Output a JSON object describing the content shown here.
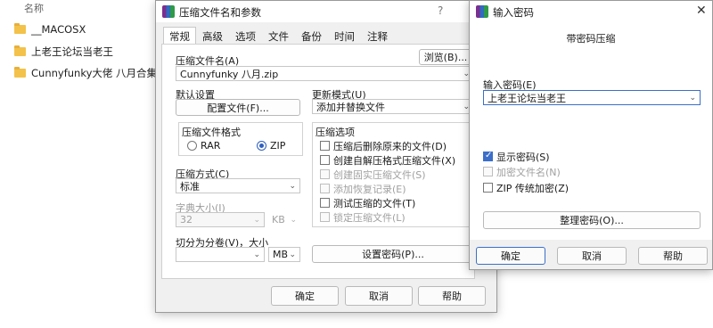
{
  "explorer": {
    "header": "名称",
    "items": [
      {
        "name": "__MACOSX"
      },
      {
        "name": "上老王论坛当老王"
      },
      {
        "name": "Cunnyfunky大佬 八月合集"
      }
    ]
  },
  "archive_dialog": {
    "title": "压缩文件名和参数",
    "help_mark": "?",
    "tabs": [
      "常规",
      "高级",
      "选项",
      "文件",
      "备份",
      "时间",
      "注释"
    ],
    "archive_name_label": "压缩文件名(A)",
    "browse_label": "浏览(B)...",
    "archive_name_value": "Cunnyfunky 八月.zip",
    "default_settings_label": "默认设置",
    "profiles_label": "配置文件(F)...",
    "update_mode_label": "更新模式(U)",
    "update_mode_value": "添加并替换文件",
    "format_label": "压缩文件格式",
    "format_rar": "RAR",
    "format_zip": "ZIP",
    "method_label": "压缩方式(C)",
    "method_value": "标准",
    "dict_label": "字典大小(I)",
    "dict_value": "32",
    "dict_unit": "KB",
    "split_label": "切分为分卷(V)，大小",
    "split_value": "",
    "split_unit": "MB",
    "set_password_label": "设置密码(P)...",
    "options_label": "压缩选项",
    "options": [
      {
        "label": "压缩后删除原来的文件(D)",
        "disabled": false
      },
      {
        "label": "创建自解压格式压缩文件(X)",
        "disabled": false
      },
      {
        "label": "创建固实压缩文件(S)",
        "disabled": true
      },
      {
        "label": "添加恢复记录(E)",
        "disabled": true
      },
      {
        "label": "测试压缩的文件(T)",
        "disabled": false
      },
      {
        "label": "锁定压缩文件(L)",
        "disabled": true
      }
    ],
    "ok_label": "确定",
    "cancel_label": "取消",
    "help_label": "帮助"
  },
  "password_dialog": {
    "title": "输入密码",
    "close_glyph": "✕",
    "subtitle": "带密码压缩",
    "enter_label": "输入密码(E)",
    "password_value": "上老王论坛当老王",
    "show_password_label": "显示密码(S)",
    "encrypt_names_label": "加密文件名(N)",
    "zip_legacy_label": "ZIP 传统加密(Z)",
    "organize_label": "整理密码(O)...",
    "ok_label": "确定",
    "cancel_label": "取消",
    "help_label": "帮助"
  }
}
